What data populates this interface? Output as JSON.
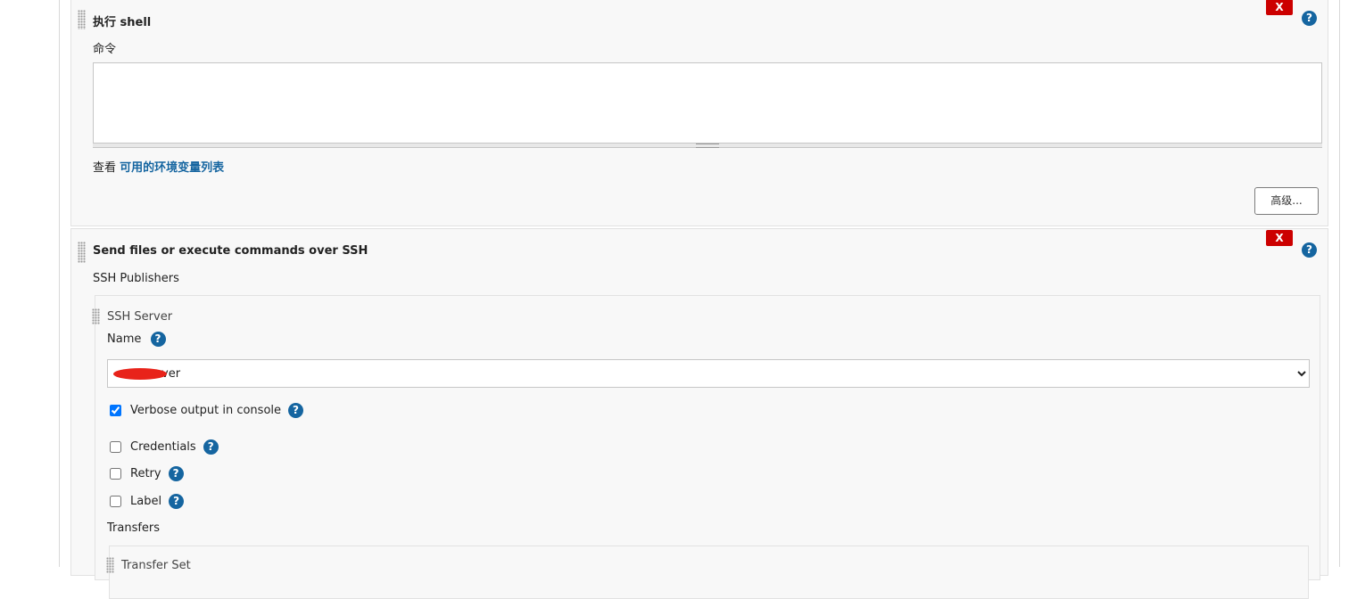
{
  "shell_step": {
    "title": "执行 shell",
    "command_label": "命令",
    "command_value": "",
    "env_prefix": "查看 ",
    "env_link": "可用的环境变量列表",
    "advanced_button": "高级...",
    "delete_label": "X",
    "help_label": "?"
  },
  "ssh_step": {
    "title": "Send files or execute commands over SSH",
    "publishers_label": "SSH Publishers",
    "delete_label": "X",
    "help_label": "?",
    "server": {
      "section_label": "SSH Server",
      "name_label": "Name",
      "name_value": "ver",
      "verbose_label": "Verbose output in console",
      "verbose_checked": true,
      "credentials_label": "Credentials",
      "credentials_checked": false,
      "retry_label": "Retry",
      "retry_checked": false,
      "label_label": "Label",
      "label_checked": false,
      "transfers_label": "Transfers",
      "transfer_set_label": "Transfer Set"
    }
  },
  "colors": {
    "delete": "#cc0000",
    "help": "#1565a0",
    "link": "#1565a0",
    "panel": "#f8f8f8"
  }
}
